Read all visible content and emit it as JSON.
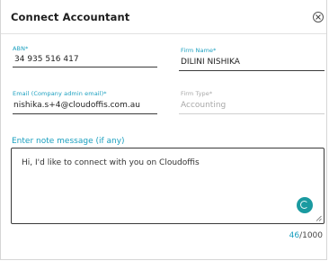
{
  "dialog": {
    "title": "Connect Accountant"
  },
  "fields": {
    "abn": {
      "label": "ABN*",
      "value": "34 935 516 417"
    },
    "firm_name": {
      "label": "Firm Name*",
      "value": "DILINI NISHIKA"
    },
    "email": {
      "label": "Email (Company admin email)*",
      "value": "nishika.s+4@cloudoffis.com.au"
    },
    "firm_type": {
      "label": "Firm Type*",
      "value": "Accounting"
    }
  },
  "note": {
    "label": "Enter note message (if any)",
    "value": "Hi, I'd like to connect with you on Cloudoffis",
    "count": "46",
    "max": "/1000"
  },
  "colors": {
    "accent": "#1a9fbf",
    "grammarly_icon": "#1a9aa0",
    "disabled_text": "#a8a8a8"
  }
}
